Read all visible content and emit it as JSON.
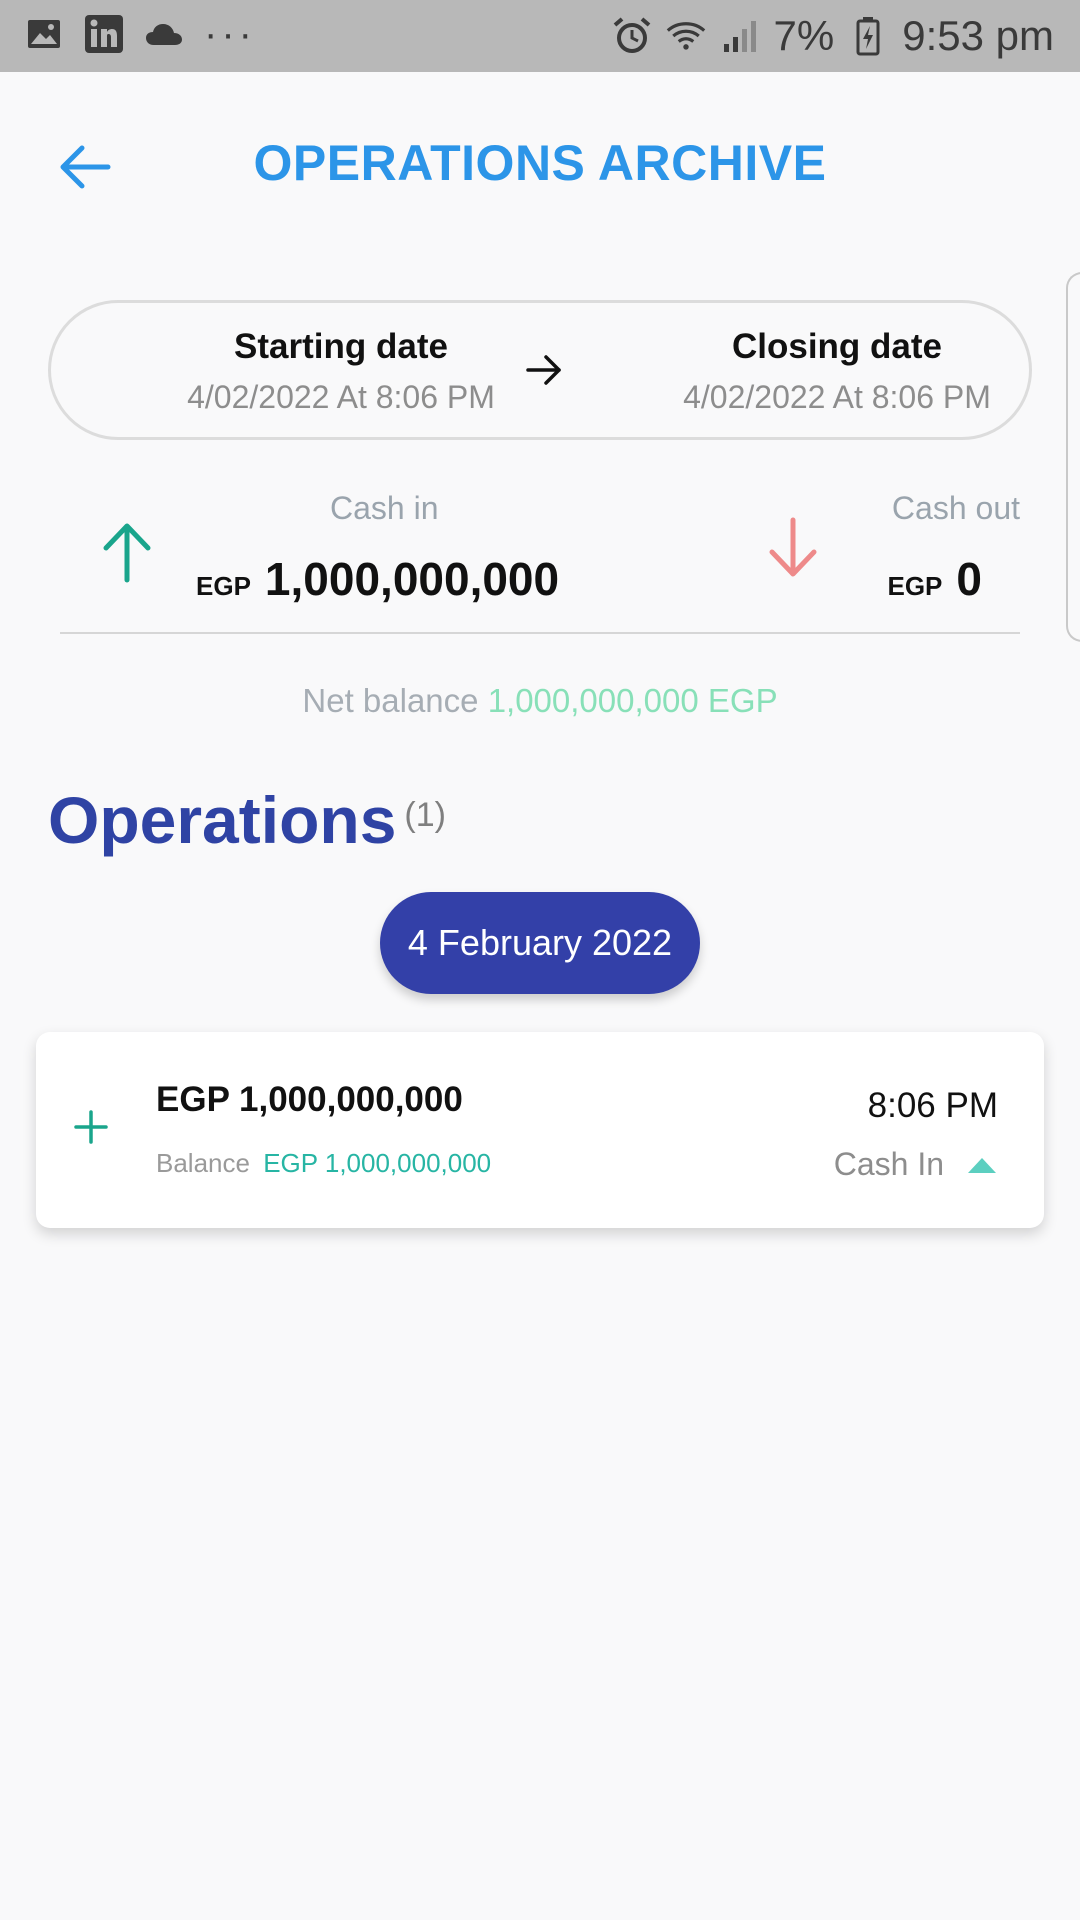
{
  "status_bar": {
    "battery": "7%",
    "time": "9:53 pm",
    "left_icons": [
      "image-icon",
      "linkedin-icon",
      "cloud-icon",
      "more-dots-icon"
    ],
    "right_icons": [
      "alarm-icon",
      "wifi-icon",
      "signal-icon",
      "battery-charging-icon"
    ]
  },
  "header": {
    "title": "OPERATIONS ARCHIVE",
    "back_icon": "arrow-left-icon"
  },
  "date_range": {
    "start_label": "Starting date",
    "start_value": "4/02/2022 At 8:06 PM",
    "close_label": "Closing date",
    "close_value": "4/02/2022 At 8:06 PM"
  },
  "cash": {
    "in_label": "Cash in",
    "in_currency": "EGP",
    "in_amount": "1,000,000,000",
    "out_label": "Cash out",
    "out_currency": "EGP",
    "out_amount": "0"
  },
  "net_balance": {
    "label": "Net balance",
    "value": "1,000,000,000 EGP"
  },
  "operations": {
    "title": "Operations",
    "count": "(1)",
    "groups": [
      {
        "date": "4 February 2022",
        "items": [
          {
            "amount": "EGP 1,000,000,000",
            "balance_label": "Balance",
            "balance_value": "EGP 1,000,000,000",
            "time": "8:06 PM",
            "type": "Cash In"
          }
        ]
      }
    ]
  },
  "colors": {
    "title_blue": "#2c95e8",
    "heading_indigo": "#2f43a4",
    "chip_indigo": "#3340a8",
    "cash_in_green": "#1aa58c",
    "cash_out_red": "#ee8a8a",
    "net_green": "#88e0b8",
    "balance_teal": "#27b5a4"
  }
}
